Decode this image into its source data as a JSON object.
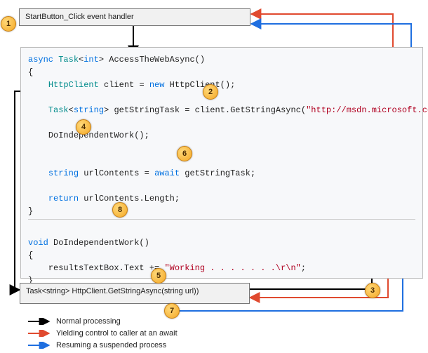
{
  "header_box": {
    "label": "StartButton_Click event handler"
  },
  "bottom_box": {
    "label": "Task<string> HttpClient.GetStringAsync(string url))"
  },
  "code": {
    "async_kw": "async",
    "task_int": "Task",
    "int_type": "int",
    "method_name": "AccessTheWebAsync()",
    "httpclient_type": "HttpClient",
    "client_decl": " client = ",
    "new_kw": "new",
    "httpclient_ctor": " HttpClient();",
    "task_string_type": "Task",
    "string_type": "string",
    "getstringtask_decl": " getStringTask = client.GetStringAsync(",
    "url_literal": "\"http://msdn.microsoft.com\"",
    "paren_semi": ");",
    "doindepcall": "DoIndependentWork();",
    "string_type2": "string",
    "urlcontents_decl": " urlContents = ",
    "await_kw": "await",
    "getstringtask_ref": " getStringTask;",
    "return_kw": "return",
    "return_expr": " urlContents.Length;",
    "void_kw": "void",
    "doindep_name": " DoIndependentWork()",
    "results_assign": "resultsTextBox.Text += ",
    "working_literal": "\"Working . . . . . . .\\r\\n\"",
    "semi": ";"
  },
  "callouts": {
    "c1": "1",
    "c2": "2",
    "c3": "3",
    "c4": "4",
    "c5": "5",
    "c6": "6",
    "c7": "7",
    "c8": "8"
  },
  "legend": {
    "normal": "Normal processing",
    "yielding": "Yielding control to caller at an await",
    "resuming": "Resuming a suspended process"
  }
}
